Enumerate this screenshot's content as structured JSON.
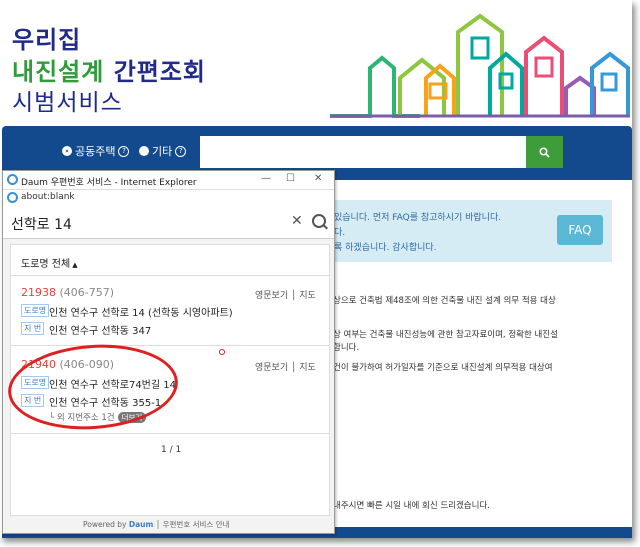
{
  "header": {
    "line1": "우리집",
    "line2_green": "내진설계",
    "line2_navy": "간편조회",
    "line3": "시범서비스"
  },
  "searchbar": {
    "radio1_label": "공동주택",
    "radio2_label": "기타",
    "help_mark": "?",
    "search_value": ""
  },
  "notice": {
    "line1": "있습니다. 먼저 FAQ를 참고하시기 바랍니다.",
    "line2": "다.",
    "line3": "록 하겠습니다. 감사합니다.",
    "faq_label": "FAQ"
  },
  "body": {
    "p1": "상으로 건축법 제48조에 의한 건축물 내진 설계 의무 적용 대상",
    "p2a": "상 여부는 건축물 내진성능에 관한 참고자료이며, 정확한 내진설",
    "p2b": "합니다.",
    "p3": "건이 불가하여 허가일자를 기준으로 내진설계 의무적용 대상여",
    "p4": "내주시면 빠른 시일 내에 회신 드리겠습니다."
  },
  "popup": {
    "window_title": "Daum 우편번호 서비스 - Internet Explorer",
    "minimize": "—",
    "maximize": "☐",
    "close": "✕",
    "address_bar": "about:blank",
    "search_value": "선학로 14",
    "clear_icon": "✕",
    "filter_label": "도로명 전체",
    "results": [
      {
        "zip_new": "21938",
        "zip_old": "(406-757)",
        "link_english": "영문보기",
        "link_map": "지도",
        "road_tag": "도로명",
        "road_address": "인천 연수구 선학로 14 (선학동 시영아파트)",
        "jibeon_tag": "지 번",
        "jibeon_address": "인천 연수구 선학동 347"
      },
      {
        "zip_new": "21940",
        "zip_old": "(406-090)",
        "link_english": "영문보기",
        "link_map": "지도",
        "road_tag": "도로명",
        "road_address": "인천 연수구 선학로74번길 14",
        "jibeon_tag": "지 번",
        "jibeon_address": "인천 연수구 선학동 355-1",
        "extra": "└ 외 지번주소 1건",
        "more_label": "더보기"
      }
    ],
    "pager": "1 / 1",
    "footer_powered": "Powered by",
    "footer_brand": "Daum",
    "footer_guide": "우편번호 서비스 안내"
  },
  "colors": {
    "navy": "#1f2a8a",
    "green": "#2f9b3a",
    "bar": "#134a8e",
    "search_button": "#3e9c3a",
    "annotation": "#e02020"
  }
}
